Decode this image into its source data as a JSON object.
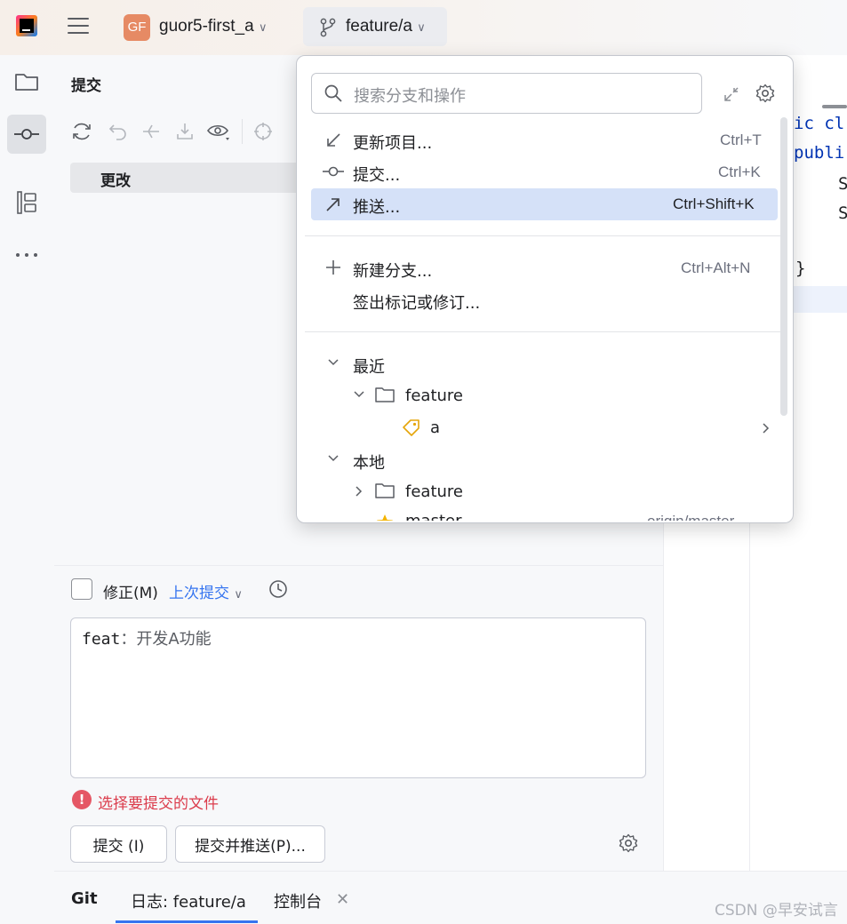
{
  "titlebar": {
    "project_badge": "GF",
    "project_name": "guor5-first_a",
    "branch": "feature/a"
  },
  "commit_panel": {
    "title": "提交",
    "changes_label": "更改",
    "amend_label": "修正(M)",
    "last_commit_label": "上次提交",
    "message_prefix": "feat",
    "message_rest": "：开发A功能",
    "error_text": "选择要提交的文件",
    "commit_button": "提交 (I)",
    "commit_push_button": "提交并推送(P)..."
  },
  "editor": {
    "lines": [
      "ic cl",
      "publi",
      "S",
      "S",
      "}"
    ]
  },
  "bottom_bar": {
    "git": "Git",
    "log_tab": "日志: feature/a",
    "console_tab": "控制台",
    "watermark": "CSDN @早安试言"
  },
  "popup": {
    "search_placeholder": "搜索分支和操作",
    "actions": [
      {
        "label": "更新项目...",
        "shortcut": "Ctrl+T",
        "icon": "update-arrow-icon"
      },
      {
        "label": "提交...",
        "shortcut": "Ctrl+K",
        "icon": "commit-icon"
      },
      {
        "label": "推送...",
        "shortcut": "Ctrl+Shift+K",
        "icon": "push-arrow-icon",
        "selected": true
      }
    ],
    "branch_actions": [
      {
        "label": "新建分支...",
        "shortcut": "Ctrl+Alt+N",
        "icon": "plus-icon"
      },
      {
        "label": "签出标记或修订...",
        "shortcut": ""
      }
    ],
    "groups": {
      "recent": "最近",
      "recent_folder": "feature",
      "recent_branch": "a",
      "local": "本地",
      "local_folder": "feature",
      "master": "master",
      "master_tracking": "origin/master"
    }
  },
  "colors": {
    "accent": "#3574f0",
    "selection": "#d5e1f8",
    "error": "#db3b4b"
  }
}
